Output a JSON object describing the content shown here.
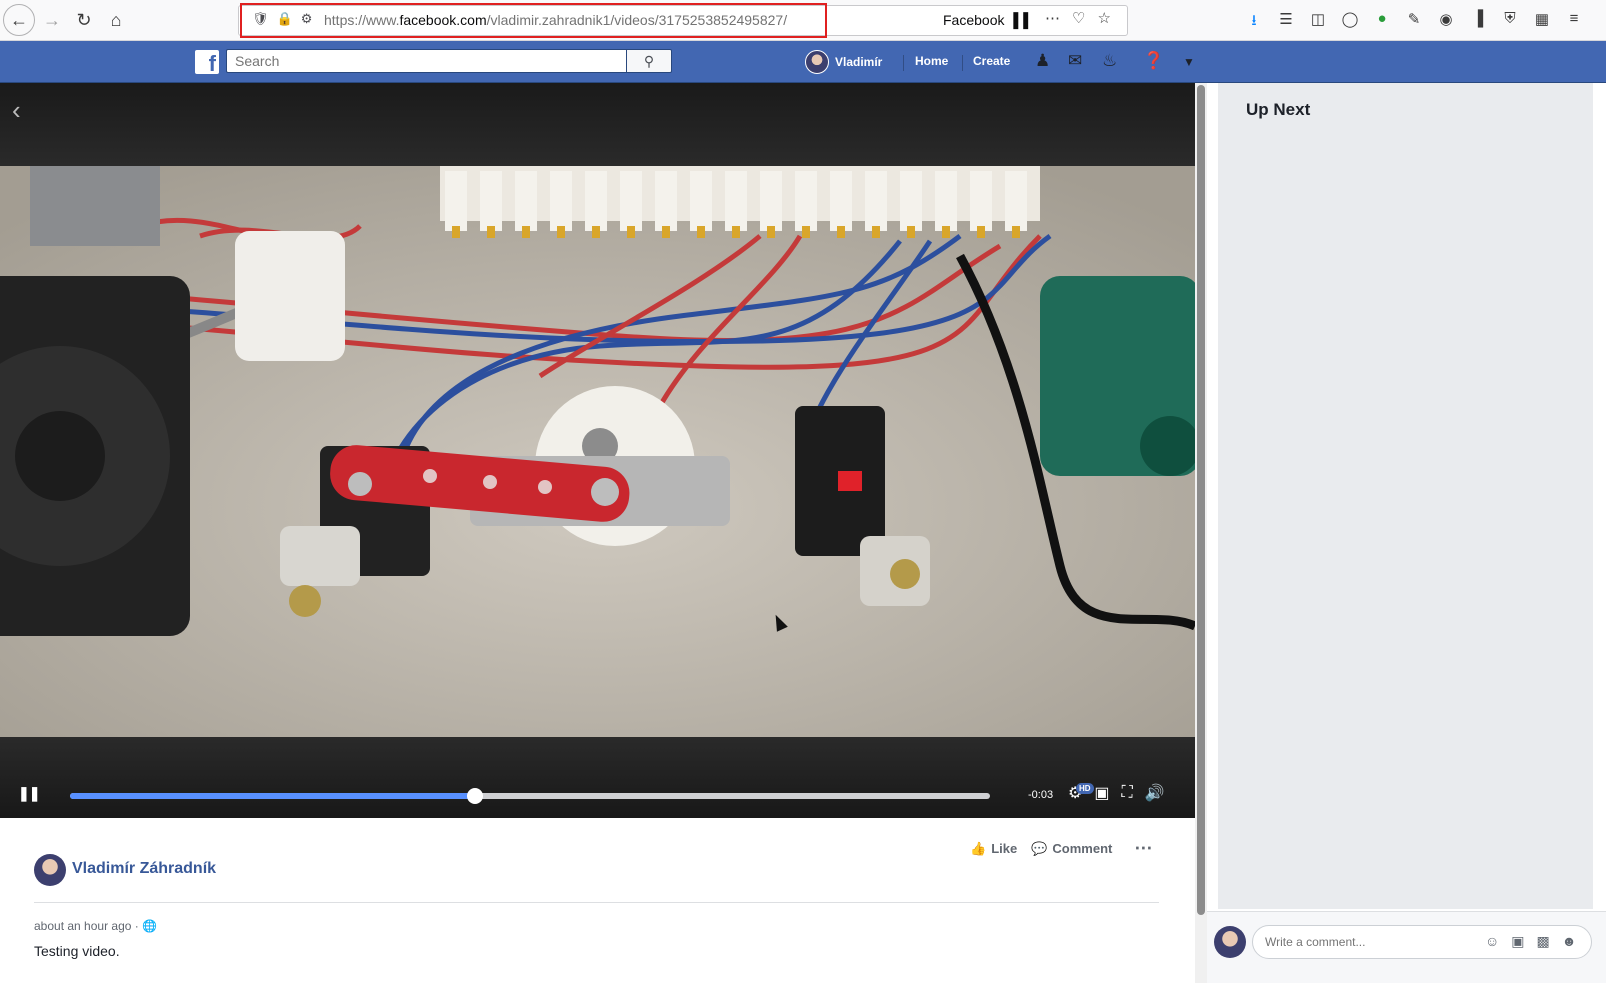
{
  "browser": {
    "url_prefix": "https://www.",
    "url_domain": "facebook.com",
    "url_path": "/vladimir.zahradnik1/videos/3175253852495827/",
    "site_label": "Facebook",
    "back_icon": "arrow-left-icon",
    "forward_icon": "arrow-right-icon",
    "reload_icon": "reload-icon",
    "home_icon": "home-icon"
  },
  "fb_header": {
    "logo": "f",
    "search_placeholder": "Search",
    "user_name": "Vladimír",
    "nav_home": "Home",
    "nav_create": "Create",
    "brand_color": "#4267b2"
  },
  "video": {
    "time_remaining": "-0:03",
    "progress_fraction": 0.44,
    "hd_label": "HD",
    "progress_color": "#5890ff"
  },
  "post": {
    "author": "Vladimír Záhradník",
    "timestamp": "about an hour ago · ",
    "text": "Testing video.",
    "like_label": "Like",
    "comment_label": "Comment"
  },
  "sidebar": {
    "title": "Up Next",
    "comment_placeholder": "Write a comment..."
  }
}
